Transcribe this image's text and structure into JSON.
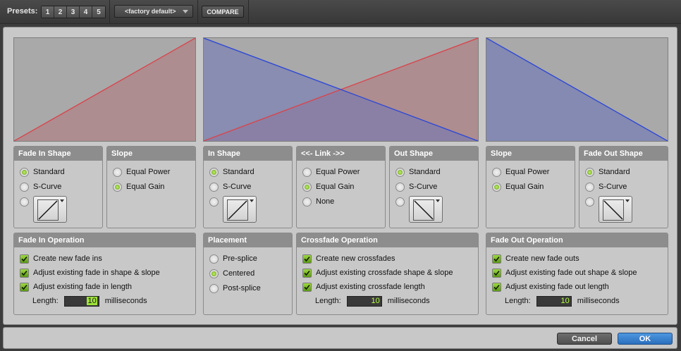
{
  "topbar": {
    "presets_label": "Presets:",
    "presets": [
      "1",
      "2",
      "3",
      "4",
      "5"
    ],
    "preset_selected": "<factory default>",
    "compare_label": "COMPARE"
  },
  "colors": {
    "fade_in_curve": "#d8454e",
    "fade_out_curve": "#2f47d6",
    "graph_bg": "#a9a9a9",
    "accent_green": "#7ac11c",
    "ok_blue": "#2f7ed0"
  },
  "fade_in_shape": {
    "title": "Fade In Shape",
    "options": [
      "Standard",
      "S-Curve"
    ],
    "selected": "Standard"
  },
  "fade_in_slope": {
    "title": "Slope",
    "options": [
      "Equal Power",
      "Equal Gain"
    ],
    "selected": "Equal Gain"
  },
  "crossfade_in_shape": {
    "title": "In Shape",
    "options": [
      "Standard",
      "S-Curve"
    ],
    "selected": "Standard"
  },
  "link": {
    "title": "<<- Link ->>",
    "options": [
      "Equal Power",
      "Equal Gain",
      "None"
    ],
    "selected": "Equal Gain"
  },
  "crossfade_out_shape": {
    "title": "Out Shape",
    "options": [
      "Standard",
      "S-Curve"
    ],
    "selected": "Standard"
  },
  "fade_out_slope": {
    "title": "Slope",
    "options": [
      "Equal Power",
      "Equal Gain"
    ],
    "selected": "Equal Gain"
  },
  "fade_out_shape": {
    "title": "Fade Out Shape",
    "options": [
      "Standard",
      "S-Curve"
    ],
    "selected": "Standard"
  },
  "fade_in_operation": {
    "title": "Fade In Operation",
    "checks": [
      "Create new fade ins",
      "Adjust existing fade in shape & slope",
      "Adjust existing fade in length"
    ],
    "length_label": "Length:",
    "length_value": "10",
    "length_unit": "milliseconds"
  },
  "placement": {
    "title": "Placement",
    "options": [
      "Pre-splice",
      "Centered",
      "Post-splice"
    ],
    "selected": "Centered"
  },
  "crossfade_operation": {
    "title": "Crossfade Operation",
    "checks": [
      "Create new crossfades",
      "Adjust existing crossfade shape & slope",
      "Adjust existing crossfade length"
    ],
    "length_label": "Length:",
    "length_value": "10",
    "length_unit": "milliseconds"
  },
  "fade_out_operation": {
    "title": "Fade Out Operation",
    "checks": [
      "Create new fade outs",
      "Adjust existing fade out shape & slope",
      "Adjust existing fade out length"
    ],
    "length_label": "Length:",
    "length_value": "10",
    "length_unit": "milliseconds"
  },
  "footer": {
    "cancel_label": "Cancel",
    "ok_label": "OK"
  }
}
